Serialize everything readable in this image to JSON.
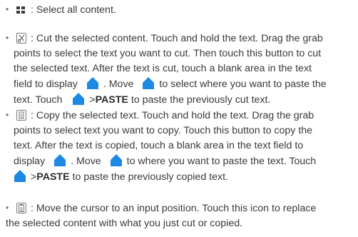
{
  "items": [
    {
      "icon": "select-all-icon",
      "lines": [
        {
          "text": ": Select all content."
        }
      ]
    },
    {
      "icon": "cut-icon",
      "lines": [
        {
          "text": ": Cut the selected content. Touch and hold the text. Drag the grab"
        },
        {
          "text": "points to select the text you want to cut. Then touch this button to cut"
        },
        {
          "text": "the selected text. After the text is cut, touch a blank area in the text"
        },
        {
          "text_a": "field to display",
          "text_b": ". Move",
          "text_c": "to select where you want to paste the"
        },
        {
          "text_a": "text. Touch",
          "text_b": ">",
          "bold": "PASTE",
          "text_c": "to paste the previously cut text."
        }
      ]
    },
    {
      "icon": "copy-icon",
      "lines": [
        {
          "text": ": Copy the selected text. Touch and hold the text. Drag the grab"
        },
        {
          "text": "points to select text you want to copy. Touch this button to copy the"
        },
        {
          "text": "text. After the text is copied, touch a blank area in the text field to"
        },
        {
          "text_a": "display",
          "text_b": ". Move",
          "text_c": "to where you want to paste the text. Touch"
        },
        {
          "text_b": ">",
          "bold": "PASTE",
          "text_c": "to paste the previously copied text."
        }
      ]
    },
    {
      "icon": "paste-icon",
      "lines": [
        {
          "text": ": Move the cursor to an input position. Touch this icon to replace"
        },
        {
          "text": "the selected content with what you just cut or copied."
        }
      ]
    }
  ],
  "bullet": "•",
  "colors": {
    "text": "#3a3a3a",
    "cursor_handle": "#1e88e5"
  }
}
